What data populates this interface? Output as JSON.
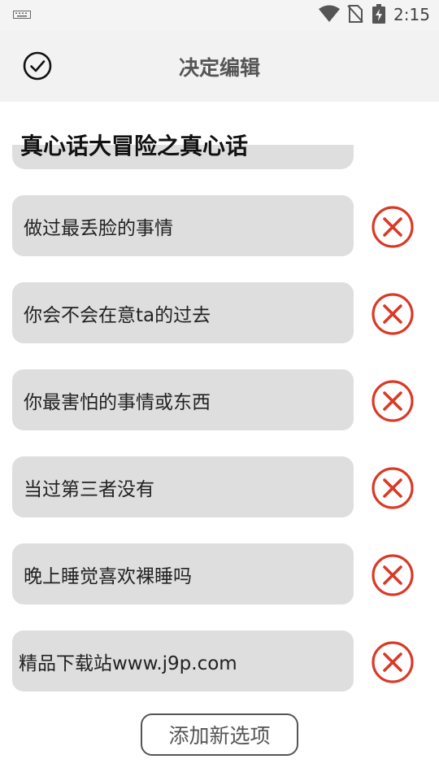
{
  "status_bar": {
    "time": "2:15",
    "icons": [
      "keyboard-icon",
      "wifi-icon",
      "no-sim-icon",
      "battery-charging-icon"
    ]
  },
  "app_bar": {
    "title": "决定编辑",
    "confirm_icon": "check-circle-icon"
  },
  "section_title": "真心话大冒险之真心话",
  "items": [
    {
      "text": "做过最丢脸的事情"
    },
    {
      "text": "你会不会在意ta的过去"
    },
    {
      "text": "你最害怕的事情或东西"
    },
    {
      "text": "当过第三者没有"
    },
    {
      "text": "晚上睡觉喜欢裸睡吗"
    },
    {
      "text": "精品下载站www.j9p.com"
    }
  ],
  "delete_icon": "close-circle-icon",
  "add_button": {
    "label": "添加新选项"
  },
  "colors": {
    "delete_red": "#d93a26",
    "field_bg": "#dedede",
    "app_bar_bg": "#f2f2f2"
  }
}
